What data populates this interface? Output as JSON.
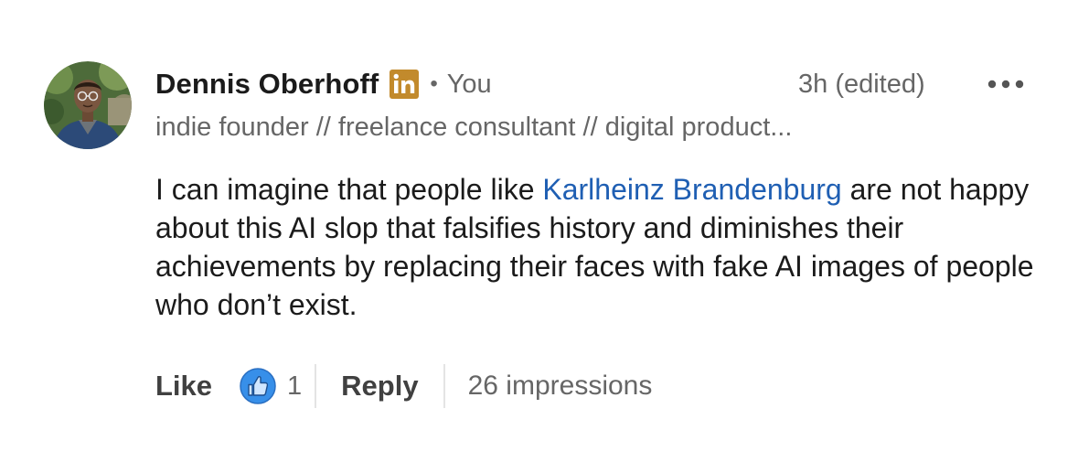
{
  "comment": {
    "author": {
      "name": "Dennis Oberhoff",
      "relation": "You",
      "headline": "indie founder // freelance consultant // digital product...",
      "badge_icon": "linkedin-icon"
    },
    "separator": "•",
    "timestamp": "3h (edited)",
    "more_icon": "ellipsis-icon",
    "body": {
      "before_mention": "I can imagine that people like ",
      "mention": "Karlheinz Brandenburg",
      "after_mention": " are not happy about this AI slop that falsifies history and diminishes their achievements by replacing their faces with fake AI images of people who don’t exist."
    },
    "actions": {
      "like_label": "Like",
      "like_icon": "thumbs-up-icon",
      "like_count": "1",
      "reply_label": "Reply",
      "impressions": "26 impressions"
    }
  },
  "colors": {
    "link": "#1f5fb3",
    "linkedin_badge": "#c28a2c",
    "like_reaction": "#378fe9",
    "secondary_text": "#666666",
    "primary_text": "#1b1b1b"
  }
}
